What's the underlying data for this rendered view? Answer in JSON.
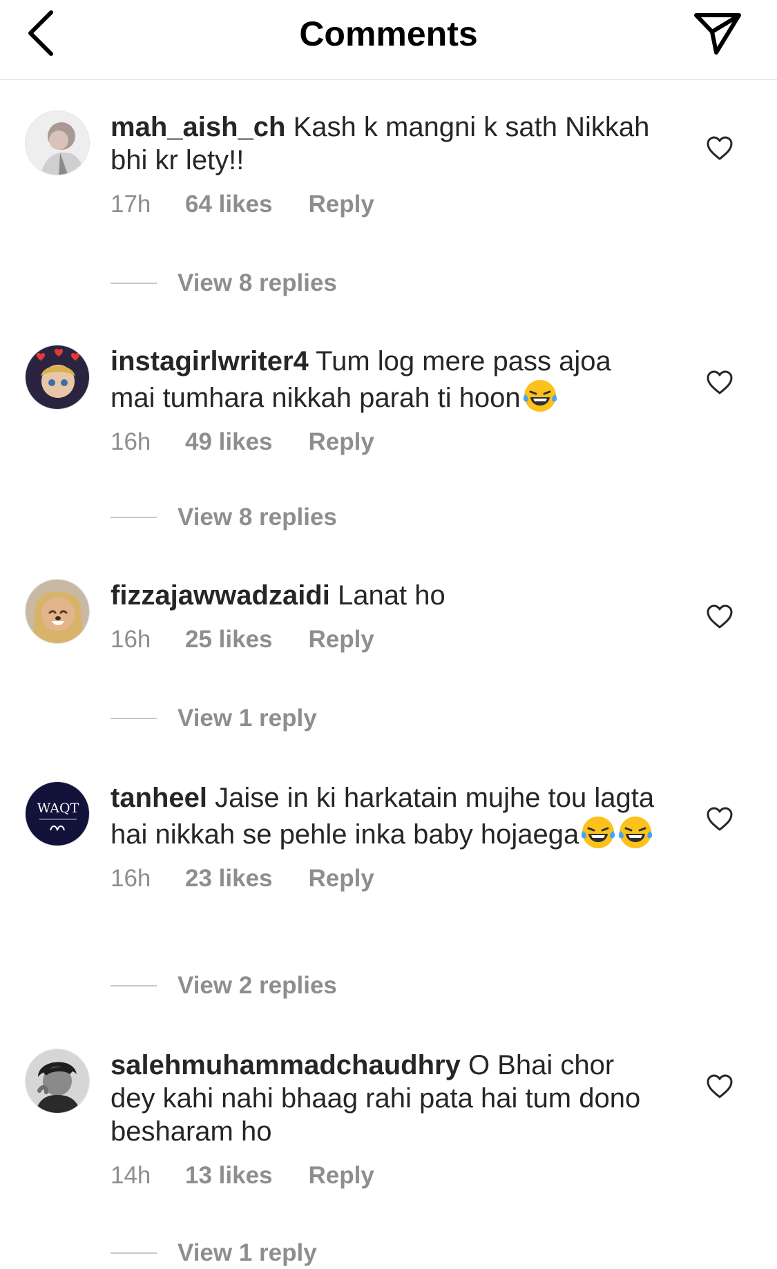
{
  "header": {
    "title": "Comments",
    "back_icon": "chevron-left-icon",
    "send_icon": "paper-plane-icon"
  },
  "comments": [
    {
      "username": "mah_aish_ch",
      "text": "Kash k mangni k sath Nikkah bhi kr lety!!",
      "time": "17h",
      "likes": "64 likes",
      "reply": "Reply",
      "view_replies": "View 8 replies"
    },
    {
      "username": "instagirlwriter4",
      "text": "Tum log mere pass ajoa mai tumhara nikkah parah ti hoon",
      "time": "16h",
      "likes": "49 likes",
      "reply": "Reply",
      "view_replies": "View 8 replies"
    },
    {
      "username": "fizzajawwadzaidi",
      "text": "Lanat ho",
      "time": "16h",
      "likes": "25 likes",
      "reply": "Reply",
      "view_replies": "View 1 reply"
    },
    {
      "username": "tanheel",
      "text": "Jaise in ki harkatain mujhe tou lagta hai nikkah se pehle inka baby hojaega",
      "time": "16h",
      "likes": "23 likes",
      "reply": "Reply",
      "view_replies": "View 2 replies"
    },
    {
      "username": "salehmuhammadchaudhry",
      "text": "O Bhai chor dey kahi nahi bhaag rahi pata hai tum dono besharam ho",
      "time": "14h",
      "likes": "13 likes",
      "reply": "Reply",
      "view_replies": "View 1 reply"
    }
  ],
  "avatar_badge_text": "WAQT",
  "colors": {
    "text": "#262626",
    "secondary": "#8e8e8e",
    "divider": "#dbdbdb"
  }
}
